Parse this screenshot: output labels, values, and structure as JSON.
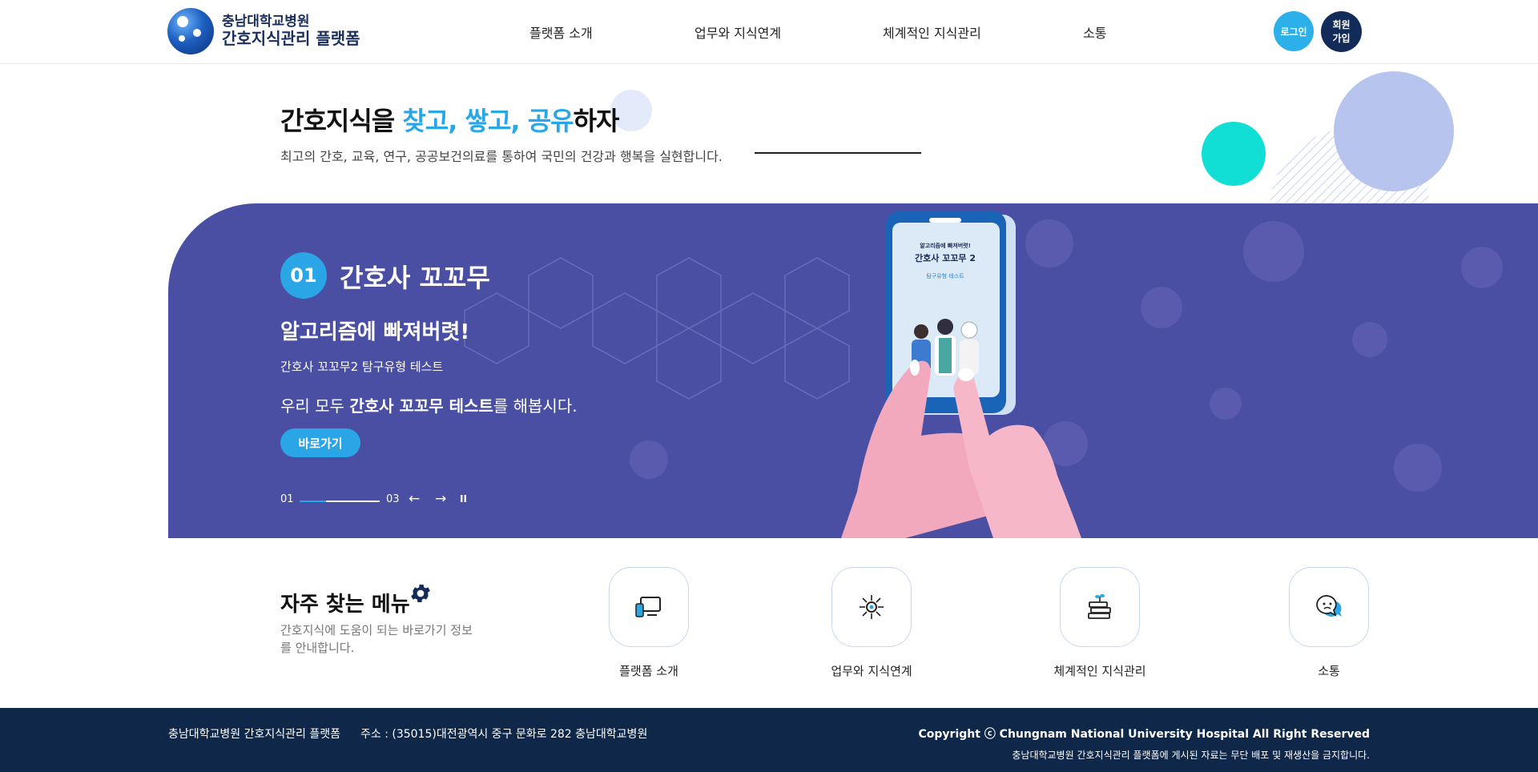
{
  "header": {
    "logo_line1": "충남대학교병원",
    "logo_line2": "간호지식관리 플랫폼",
    "nav": [
      "플랫폼 소개",
      "업무와 지식연계",
      "체계적인 지식관리",
      "소통"
    ],
    "login_label": "로그인",
    "join_label_1": "회원",
    "join_label_2": "가입"
  },
  "hero": {
    "headline_prefix": "간호지식을 ",
    "headline_accent": "찾고, 쌓고, 공유",
    "headline_suffix": "하자",
    "subline": "최고의 간호, 교육, 연구, 공공보건의료를 통하여 국민의 건강과 행복을 실현합니다."
  },
  "banner": {
    "number": "01",
    "title": "간호사 꼬꼬무",
    "heading": "알고리즘에 빠져버렷!",
    "small_text": "간호사 꼬꼬무2 탐구유형 테스트",
    "desc_prefix": "우리 모두 ",
    "desc_bold": "간호사 꼬꼬무 테스트",
    "desc_suffix": "를 해봅시다.",
    "button_label": "바로가기",
    "pager_current": "01",
    "pager_total": "03",
    "pager_progress": 0.33,
    "phone_small": "알고리즘에 빠져버렷!",
    "phone_title": "간호사 꼬꼬무 2",
    "phone_sub": "탐구유형 테스트"
  },
  "frequent": {
    "title": "자주 찾는 메뉴",
    "desc": "간호지식에 도움이 되는 바로가기 정보를 안내합니다.",
    "items": [
      {
        "label": "플랫폼 소개",
        "icon": "monitor-icon"
      },
      {
        "label": "업무와 지식연계",
        "icon": "network-icon"
      },
      {
        "label": "체계적인 지식관리",
        "icon": "books-icon"
      },
      {
        "label": "소통",
        "icon": "chat-icon"
      }
    ]
  },
  "footer": {
    "site_name": "충남대학교병원 간호지식관리 플랫폼",
    "address": "주소 : (35015)대전광역시 중구 문화로 282 충남대학교병원",
    "copyright": "Copyright ⓒ Chungnam National University Hospital All Right Reserved",
    "notice": "충남대학교병원 간호지식관리 플랫폼에 게시된 자료는 무단 배포 및 재생산을 금지합니다."
  },
  "colors": {
    "accent": "#2aa6e6",
    "banner": "#4a4fa3",
    "navy": "#132b58",
    "footer": "#0f2749"
  }
}
